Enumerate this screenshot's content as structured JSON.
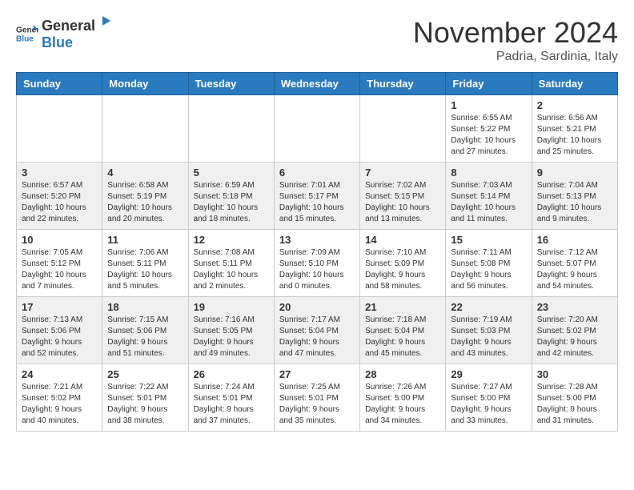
{
  "header": {
    "logo": {
      "general": "General",
      "blue": "Blue"
    },
    "month_title": "November 2024",
    "location": "Padria, Sardinia, Italy"
  },
  "days_of_week": [
    "Sunday",
    "Monday",
    "Tuesday",
    "Wednesday",
    "Thursday",
    "Friday",
    "Saturday"
  ],
  "weeks": [
    [
      {
        "day": "",
        "info": ""
      },
      {
        "day": "",
        "info": ""
      },
      {
        "day": "",
        "info": ""
      },
      {
        "day": "",
        "info": ""
      },
      {
        "day": "",
        "info": ""
      },
      {
        "day": "1",
        "info": "Sunrise: 6:55 AM\nSunset: 5:22 PM\nDaylight: 10 hours\nand 27 minutes."
      },
      {
        "day": "2",
        "info": "Sunrise: 6:56 AM\nSunset: 5:21 PM\nDaylight: 10 hours\nand 25 minutes."
      }
    ],
    [
      {
        "day": "3",
        "info": "Sunrise: 6:57 AM\nSunset: 5:20 PM\nDaylight: 10 hours\nand 22 minutes."
      },
      {
        "day": "4",
        "info": "Sunrise: 6:58 AM\nSunset: 5:19 PM\nDaylight: 10 hours\nand 20 minutes."
      },
      {
        "day": "5",
        "info": "Sunrise: 6:59 AM\nSunset: 5:18 PM\nDaylight: 10 hours\nand 18 minutes."
      },
      {
        "day": "6",
        "info": "Sunrise: 7:01 AM\nSunset: 5:17 PM\nDaylight: 10 hours\nand 15 minutes."
      },
      {
        "day": "7",
        "info": "Sunrise: 7:02 AM\nSunset: 5:15 PM\nDaylight: 10 hours\nand 13 minutes."
      },
      {
        "day": "8",
        "info": "Sunrise: 7:03 AM\nSunset: 5:14 PM\nDaylight: 10 hours\nand 11 minutes."
      },
      {
        "day": "9",
        "info": "Sunrise: 7:04 AM\nSunset: 5:13 PM\nDaylight: 10 hours\nand 9 minutes."
      }
    ],
    [
      {
        "day": "10",
        "info": "Sunrise: 7:05 AM\nSunset: 5:12 PM\nDaylight: 10 hours\nand 7 minutes."
      },
      {
        "day": "11",
        "info": "Sunrise: 7:06 AM\nSunset: 5:11 PM\nDaylight: 10 hours\nand 5 minutes."
      },
      {
        "day": "12",
        "info": "Sunrise: 7:08 AM\nSunset: 5:11 PM\nDaylight: 10 hours\nand 2 minutes."
      },
      {
        "day": "13",
        "info": "Sunrise: 7:09 AM\nSunset: 5:10 PM\nDaylight: 10 hours\nand 0 minutes."
      },
      {
        "day": "14",
        "info": "Sunrise: 7:10 AM\nSunset: 5:09 PM\nDaylight: 9 hours\nand 58 minutes."
      },
      {
        "day": "15",
        "info": "Sunrise: 7:11 AM\nSunset: 5:08 PM\nDaylight: 9 hours\nand 56 minutes."
      },
      {
        "day": "16",
        "info": "Sunrise: 7:12 AM\nSunset: 5:07 PM\nDaylight: 9 hours\nand 54 minutes."
      }
    ],
    [
      {
        "day": "17",
        "info": "Sunrise: 7:13 AM\nSunset: 5:06 PM\nDaylight: 9 hours\nand 52 minutes."
      },
      {
        "day": "18",
        "info": "Sunrise: 7:15 AM\nSunset: 5:06 PM\nDaylight: 9 hours\nand 51 minutes."
      },
      {
        "day": "19",
        "info": "Sunrise: 7:16 AM\nSunset: 5:05 PM\nDaylight: 9 hours\nand 49 minutes."
      },
      {
        "day": "20",
        "info": "Sunrise: 7:17 AM\nSunset: 5:04 PM\nDaylight: 9 hours\nand 47 minutes."
      },
      {
        "day": "21",
        "info": "Sunrise: 7:18 AM\nSunset: 5:04 PM\nDaylight: 9 hours\nand 45 minutes."
      },
      {
        "day": "22",
        "info": "Sunrise: 7:19 AM\nSunset: 5:03 PM\nDaylight: 9 hours\nand 43 minutes."
      },
      {
        "day": "23",
        "info": "Sunrise: 7:20 AM\nSunset: 5:02 PM\nDaylight: 9 hours\nand 42 minutes."
      }
    ],
    [
      {
        "day": "24",
        "info": "Sunrise: 7:21 AM\nSunset: 5:02 PM\nDaylight: 9 hours\nand 40 minutes."
      },
      {
        "day": "25",
        "info": "Sunrise: 7:22 AM\nSunset: 5:01 PM\nDaylight: 9 hours\nand 38 minutes."
      },
      {
        "day": "26",
        "info": "Sunrise: 7:24 AM\nSunset: 5:01 PM\nDaylight: 9 hours\nand 37 minutes."
      },
      {
        "day": "27",
        "info": "Sunrise: 7:25 AM\nSunset: 5:01 PM\nDaylight: 9 hours\nand 35 minutes."
      },
      {
        "day": "28",
        "info": "Sunrise: 7:26 AM\nSunset: 5:00 PM\nDaylight: 9 hours\nand 34 minutes."
      },
      {
        "day": "29",
        "info": "Sunrise: 7:27 AM\nSunset: 5:00 PM\nDaylight: 9 hours\nand 33 minutes."
      },
      {
        "day": "30",
        "info": "Sunrise: 7:28 AM\nSunset: 5:00 PM\nDaylight: 9 hours\nand 31 minutes."
      }
    ]
  ]
}
